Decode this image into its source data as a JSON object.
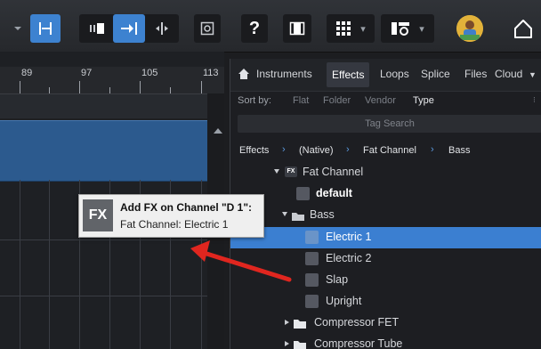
{
  "toolbar": {
    "help_label": "?",
    "icons": [
      "arrow-down-icon",
      "insert-marker-icon",
      "track-left-icon",
      "track-right-icon",
      "split-icon",
      "fullscreen-icon",
      "help-icon",
      "film-icon",
      "grid-icon",
      "mixer-icon",
      "avatar",
      "home-icon"
    ]
  },
  "ruler": {
    "labels": [
      "89",
      "97",
      "105",
      "113"
    ]
  },
  "browser": {
    "tabs": [
      {
        "label": "Instruments",
        "active": false
      },
      {
        "label": "Effects",
        "active": true
      },
      {
        "label": "Loops",
        "active": false
      },
      {
        "label": "Splice",
        "active": false
      },
      {
        "label": "Files",
        "active": false
      },
      {
        "label": "Cloud",
        "active": false
      }
    ],
    "sort_label": "Sort by:",
    "sort_options": [
      {
        "label": "Flat",
        "active": false
      },
      {
        "label": "Folder",
        "active": false
      },
      {
        "label": "Vendor",
        "active": false
      },
      {
        "label": "Type",
        "active": true
      }
    ],
    "search_placeholder": "Tag Search",
    "breadcrumb": [
      "Effects",
      "(Native)",
      "Fat Channel",
      "Bass"
    ],
    "tree": [
      {
        "label": "Fat Channel",
        "kind": "plugin",
        "badge": "FX"
      },
      {
        "label": "default",
        "kind": "preset"
      },
      {
        "label": "Bass",
        "kind": "folder-open"
      },
      {
        "label": "Electric 1",
        "kind": "preset",
        "selected": true
      },
      {
        "label": "Electric 2",
        "kind": "preset"
      },
      {
        "label": "Slap",
        "kind": "preset"
      },
      {
        "label": "Upright",
        "kind": "preset"
      },
      {
        "label": "Compressor FET",
        "kind": "folder"
      },
      {
        "label": "Compressor Tube",
        "kind": "folder"
      }
    ]
  },
  "tooltip": {
    "badge": "FX",
    "title": "Add FX on Channel \"D 1\":",
    "subtitle": "Fat Channel: Electric 1"
  },
  "colors": {
    "accent": "#3b7fd1",
    "clip": "#2c5a8e",
    "arrow": "#e0261f"
  }
}
